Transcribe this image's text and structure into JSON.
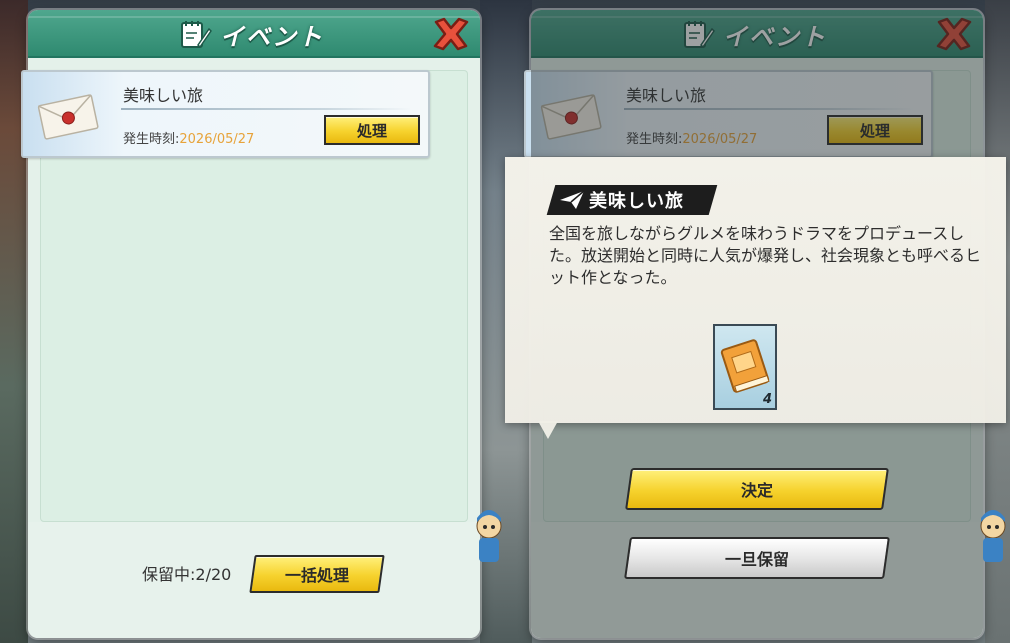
{
  "left_panel": {
    "title": "イベント",
    "event": {
      "name": "美味しい旅",
      "date_label": "発生時刻:",
      "date_value": "2026/05/27",
      "action_label": "処理"
    },
    "pending_label": "保留中:2/20",
    "bulk_label": "一括処理"
  },
  "right_panel": {
    "title": "イベント",
    "event": {
      "name": "美味しい旅",
      "date_label": "発生時刻:",
      "date_value": "2026/05/27",
      "action_label": "処理"
    },
    "popup": {
      "title": "美味しい旅",
      "description": "全国を旅しながらグルメを味わうドラマをプロデュースした。放送開始と同時に人気が爆発し、社会現象とも呼べるヒット作となった。",
      "item_icon": "book-icon",
      "item_count": "4"
    },
    "decide_label": "決定",
    "hold_label": "一旦保留"
  },
  "colors": {
    "header": "#2f8a70",
    "yellow_button": "#f6d22d",
    "date_accent": "#e7a33a"
  }
}
